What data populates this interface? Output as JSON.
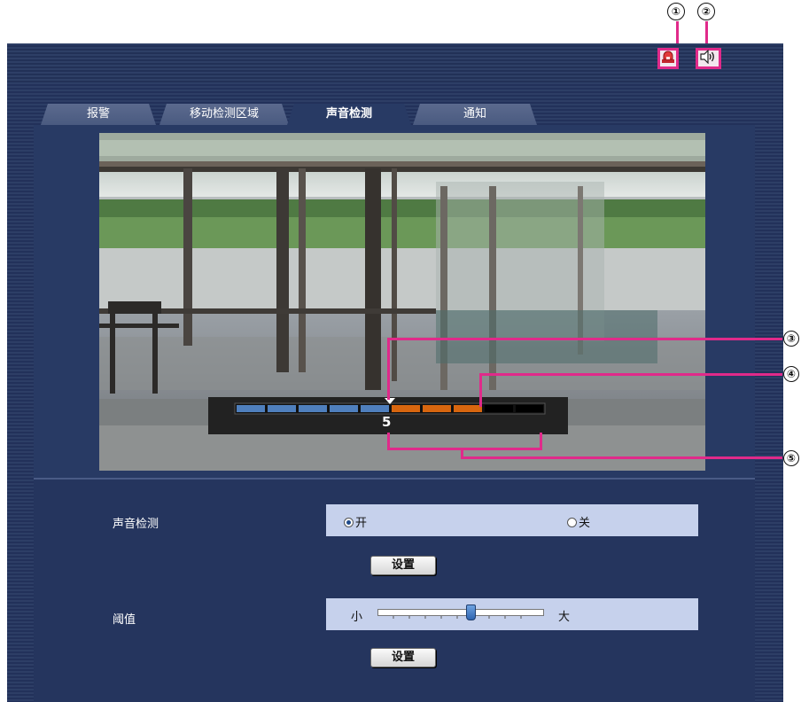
{
  "callouts": {
    "n1": "①",
    "n2": "②",
    "n3": "③",
    "n4": "④",
    "n5": "⑤"
  },
  "toolbar": {
    "alarm_icon": "alarm-icon",
    "sound_icon": "speaker-icon",
    "accent": "#e02a8a"
  },
  "tabs": [
    {
      "label": "报警",
      "active": false
    },
    {
      "label": "移动检测区域",
      "active": false
    },
    {
      "label": "声音检测",
      "active": true
    },
    {
      "label": "通知",
      "active": false
    }
  ],
  "level_meter": {
    "value": "5",
    "segments": 10,
    "current_level": 5,
    "threshold_level": 5
  },
  "form": {
    "sound_detection": {
      "label": "声音检测",
      "on_label": "开",
      "off_label": "关",
      "selected": "开"
    },
    "set_button_1": "设置",
    "threshold": {
      "label": "阈值",
      "min_label": "小",
      "max_label": "大",
      "value_fraction": 0.56
    },
    "set_button_2": "设置"
  }
}
